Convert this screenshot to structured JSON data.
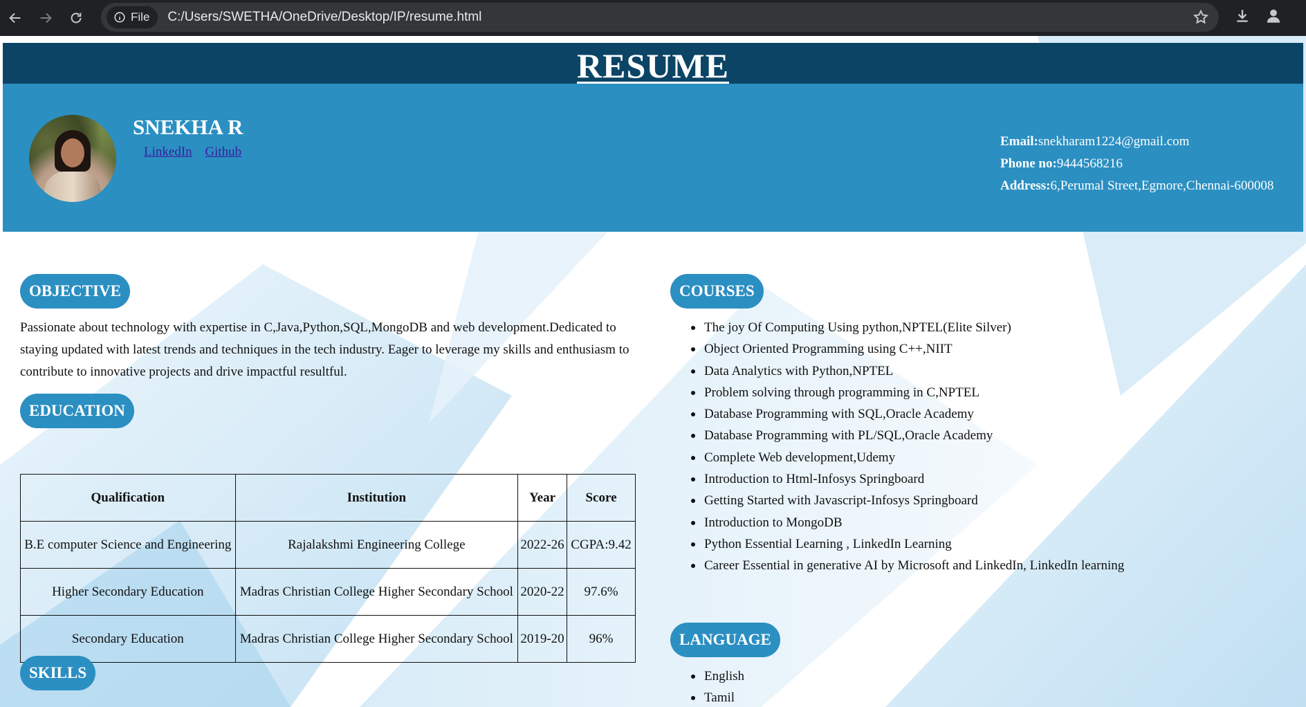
{
  "browser": {
    "site_chip": "File",
    "url": "C:/Users/SWETHA/OneDrive/Desktop/IP/resume.html"
  },
  "page": {
    "title": "RESUME",
    "name": "SNEKHA R",
    "links": [
      "LinkedIn",
      "Github"
    ],
    "contact": {
      "email_label": "Email:",
      "email": "snekharam1224@gmail.com",
      "phone_label": "Phone no:",
      "phone": "9444568216",
      "address_label": "Address:",
      "address": "6,Perumal Street,Egmore,Chennai-600008"
    },
    "objective": {
      "heading": "OBJECTIVE",
      "text": "Passionate about technology with expertise in C,Java,Python,SQL,MongoDB and web development.Dedicated to staying updated with latest trends and techniques in the tech industry. Eager to leverage my skills and enthusiasm to contribute to innovative projects and drive impactful resultful."
    },
    "education": {
      "heading": "EDUCATION",
      "columns": [
        "Qualification",
        "Institution",
        "Year",
        "Score"
      ],
      "rows": [
        [
          "B.E computer Science and Engineering",
          "Rajalakshmi Engineering College",
          "2022-26",
          "CGPA:9.42"
        ],
        [
          "Higher Secondary Education",
          "Madras Christian College Higher Secondary School",
          "2020-22",
          "97.6%"
        ],
        [
          "Secondary Education",
          "Madras Christian College Higher Secondary School",
          "2019-20",
          "96%"
        ]
      ]
    },
    "skills": {
      "heading": "SKILLS"
    },
    "courses": {
      "heading": "COURSES",
      "items": [
        "The joy Of Computing Using python,NPTEL(Elite Silver)",
        "Object Oriented Programming using C++,NIIT",
        "Data Analytics with Python,NPTEL",
        "Problem solving through programming in C,NPTEL",
        "Database Programming with SQL,Oracle Academy",
        "Database Programming with PL/SQL,Oracle Academy",
        "Complete Web development,Udemy",
        "Introduction to Html-Infosys Springboard",
        "Getting Started with Javascript-Infosys Springboard",
        "Introduction to MongoDB",
        "Python Essential Learning , LinkedIn Learning",
        "Career Essential in generative AI by Microsoft and LinkedIn, LinkedIn learning"
      ]
    },
    "language": {
      "heading": "LANGUAGE",
      "items": [
        "English",
        "Tamil"
      ]
    }
  },
  "colors": {
    "chrome_bg": "#202124",
    "title_bar": "#0c4466",
    "header_bg": "#2b8fc2",
    "pill_bg": "#2b8fc2",
    "link": "#3d1ea0"
  },
  "icons": [
    "back-arrow-icon",
    "forward-arrow-icon",
    "reload-icon",
    "info-icon",
    "star-icon",
    "download-icon",
    "profile-icon"
  ]
}
